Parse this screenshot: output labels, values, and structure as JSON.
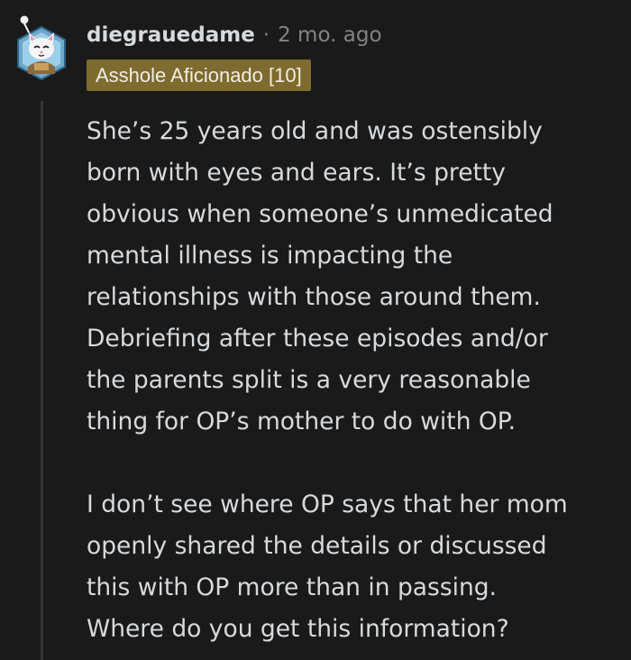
{
  "comment": {
    "author": "diegrauedame",
    "separator": "·",
    "timestamp": "2 mo. ago",
    "flair": "Asshole Aficionado [10]",
    "avatar_icon": "cat-avatar-icon",
    "paragraphs": [
      {
        "lines": [
          "She’s 25 years old and was ostensibly",
          "born with eyes and ears. It’s pretty",
          "obvious when someone’s unmedicated",
          "mental illness is impacting the",
          "relationships with those around them.",
          "Debriefing after these episodes and/or",
          "the parents split is a very reasonable",
          "thing for OP’s mother to do with OP."
        ]
      },
      {
        "lines": [
          "I don’t see where OP says that her mom",
          "openly shared the details or discussed",
          "this with OP more than in passing.",
          "Where do you get this information?"
        ]
      }
    ]
  },
  "colors": {
    "background": "#1a1a1b",
    "text": "#d7dadc",
    "muted": "#818384",
    "flair_bg": "#7d6b2f",
    "thread_line": "#343536"
  }
}
